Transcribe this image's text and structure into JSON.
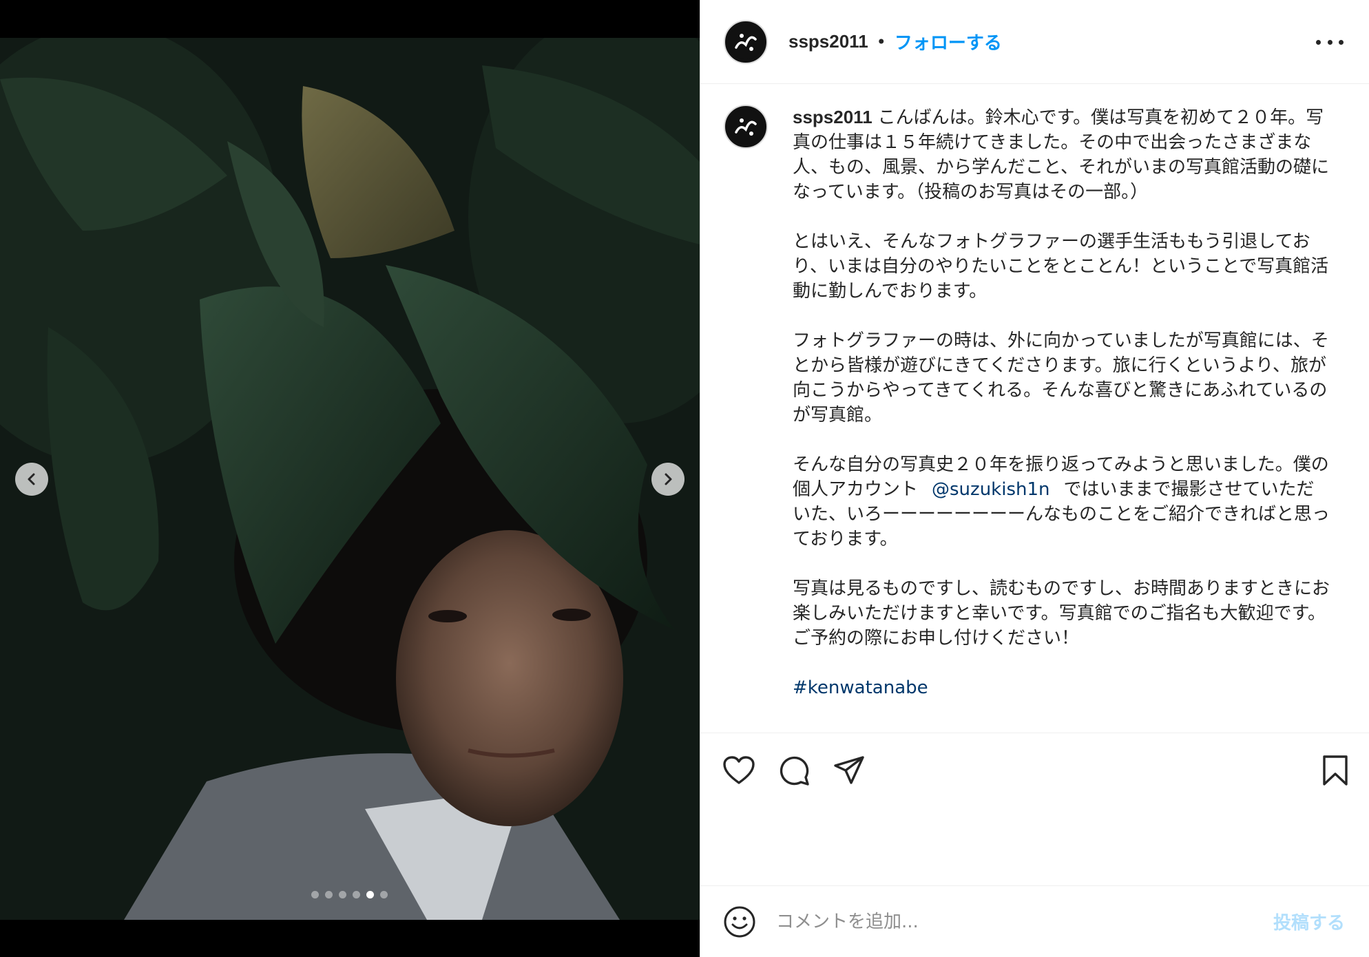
{
  "post": {
    "username": "ssps2011",
    "follow_label": "フォローする",
    "separator": "•"
  },
  "caption": {
    "username": "ssps2011",
    "paragraph1": "こんばんは。鈴木心です。僕は写真を初めて２０年。写真の仕事は１５年続けてきました。その中で出会ったさまざまな人、もの、風景、から学んだこと、それがいまの写真館活動の礎になっています。（投稿のお写真はその一部。）",
    "paragraph2": "とはいえ、そんなフォトグラファーの選手生活ももう引退しており、いまは自分のやりたいことをとことん！ということで写真館活動に勤しんでおります。",
    "paragraph3": "フォトグラファーの時は、外に向かっていましたが写真館には、そとから皆様が遊びにきてくださります。旅に行くというより、旅が向こうからやってきてくれる。そんな喜びと驚きにあふれているのが写真館。",
    "paragraph4_before": "そんな自分の写真史２０年を振り返ってみようと思いました。僕の個人アカウント",
    "mention": "@suzukish1n",
    "paragraph4_after": "ではいままで撮影させていただいた、いろーーーーーーーーんなものことをご紹介できればと思っております。",
    "paragraph5": "写真は見るものですし、読むものですし、お時間ありますときにお楽しみいただけますと幸いです。写真館でのご指名も大歓迎です。ご予約の際にお申し付けください！",
    "hashtag": "#kenwatanabe"
  },
  "carousel": {
    "slide_count": 6,
    "active_index": 4
  },
  "comment": {
    "placeholder": "コメントを追加...",
    "post_label": "投稿する"
  },
  "icons": {
    "prev": "chevron-left-icon",
    "next": "chevron-right-icon",
    "like": "heart-icon",
    "comment": "comment-icon",
    "share": "paper-plane-icon",
    "save": "bookmark-icon",
    "emoji": "smiley-icon",
    "more": "ellipsis-icon"
  },
  "colors": {
    "accent": "#0095f6",
    "link": "#00376b",
    "post_disabled": "#b2dffc"
  }
}
